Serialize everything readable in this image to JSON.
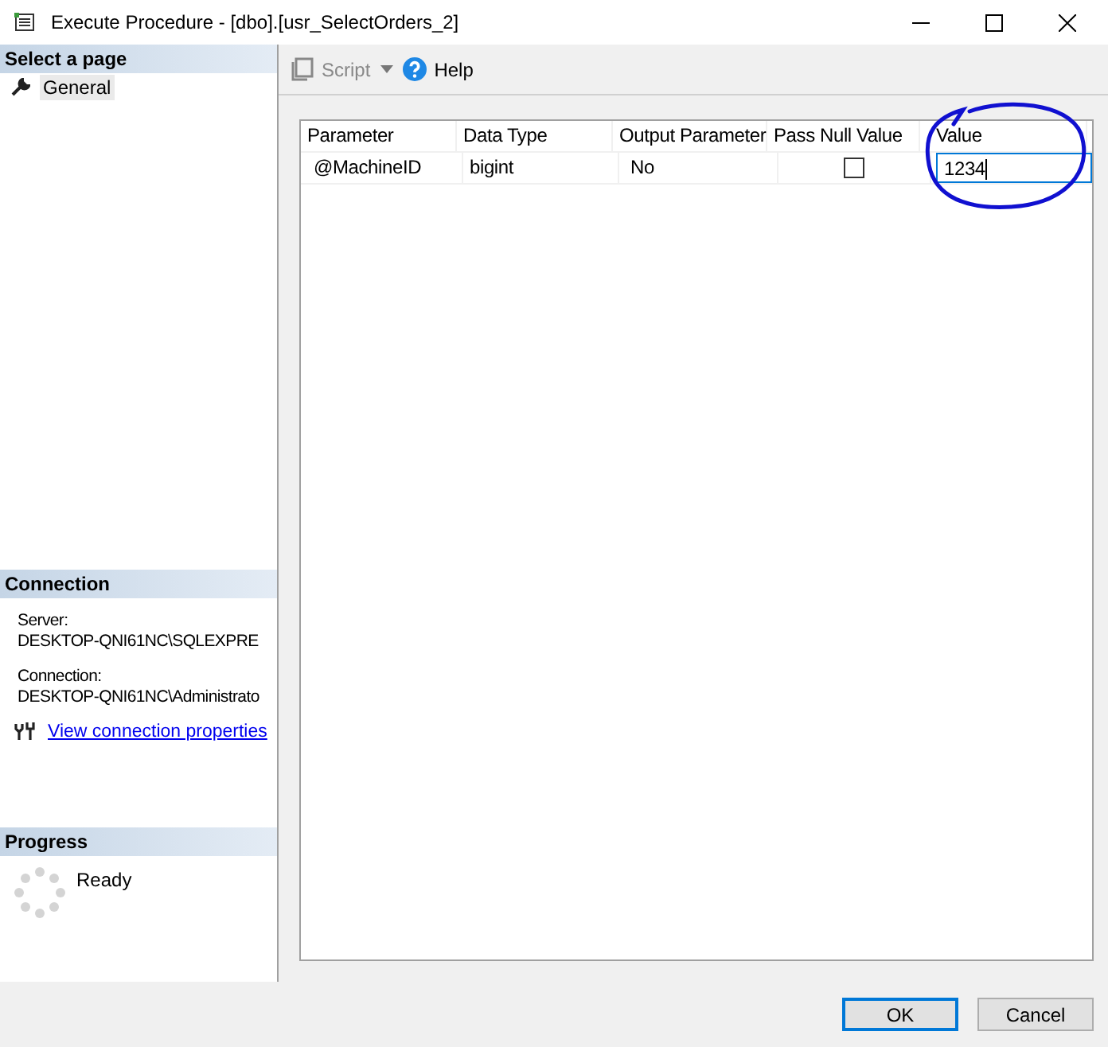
{
  "window": {
    "title": "Execute Procedure - [dbo].[usr_SelectOrders_2]"
  },
  "sidebar": {
    "header": "Select a page",
    "pages": [
      {
        "label": "General",
        "selected": true
      }
    ],
    "connection": {
      "header": "Connection",
      "server_label": "Server:",
      "server": "DESKTOP-QNI61NC\\SQLEXPRE",
      "connection_label": "Connection:",
      "connection": "DESKTOP-QNI61NC\\Administrato",
      "link": "View connection properties"
    },
    "progress": {
      "header": "Progress",
      "status": "Ready"
    }
  },
  "toolbar": {
    "script": {
      "label": "Script",
      "disabled": true
    },
    "help": {
      "label": "Help"
    }
  },
  "grid": {
    "columns": [
      "Parameter",
      "Data Type",
      "Output Parameter",
      "Pass Null Value",
      "Value"
    ],
    "rows": [
      {
        "parameter": "@MachineID",
        "data_type": "bigint",
        "output_parameter": "No",
        "pass_null": false,
        "value": "1234",
        "editing": true
      }
    ]
  },
  "buttons": [
    {
      "label": "OK",
      "default": true
    },
    {
      "label": "Cancel",
      "default": false
    }
  ]
}
